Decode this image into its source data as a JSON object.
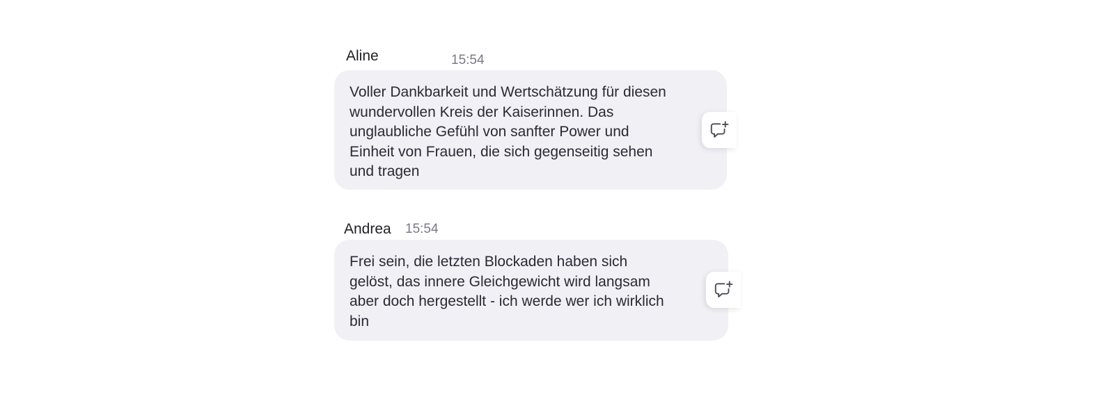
{
  "messages": [
    {
      "sender": "Aline",
      "time": "15:54",
      "text": "Voller Dankbarkeit und Wertschätzung für diesen\nwundervollen Kreis der Kaiserinnen. Das\nunglaubliche Gefühl von sanfter Power und\nEinheit von Frauen, die sich gegenseitig sehen\nund tragen",
      "action_icon": "add-comment-icon"
    },
    {
      "sender": "Andrea",
      "time": "15:54",
      "text": "Frei sein, die letzten Blockaden haben sich\ngelöst, das innere Gleichgewicht wird langsam\naber doch hergestellt - ich werde wer ich wirklich\nbin",
      "action_icon": "add-comment-icon"
    }
  ],
  "colors": {
    "bubble_background": "#f1f0f5",
    "timestamp": "#7a7a86",
    "text": "#2a2a35"
  }
}
